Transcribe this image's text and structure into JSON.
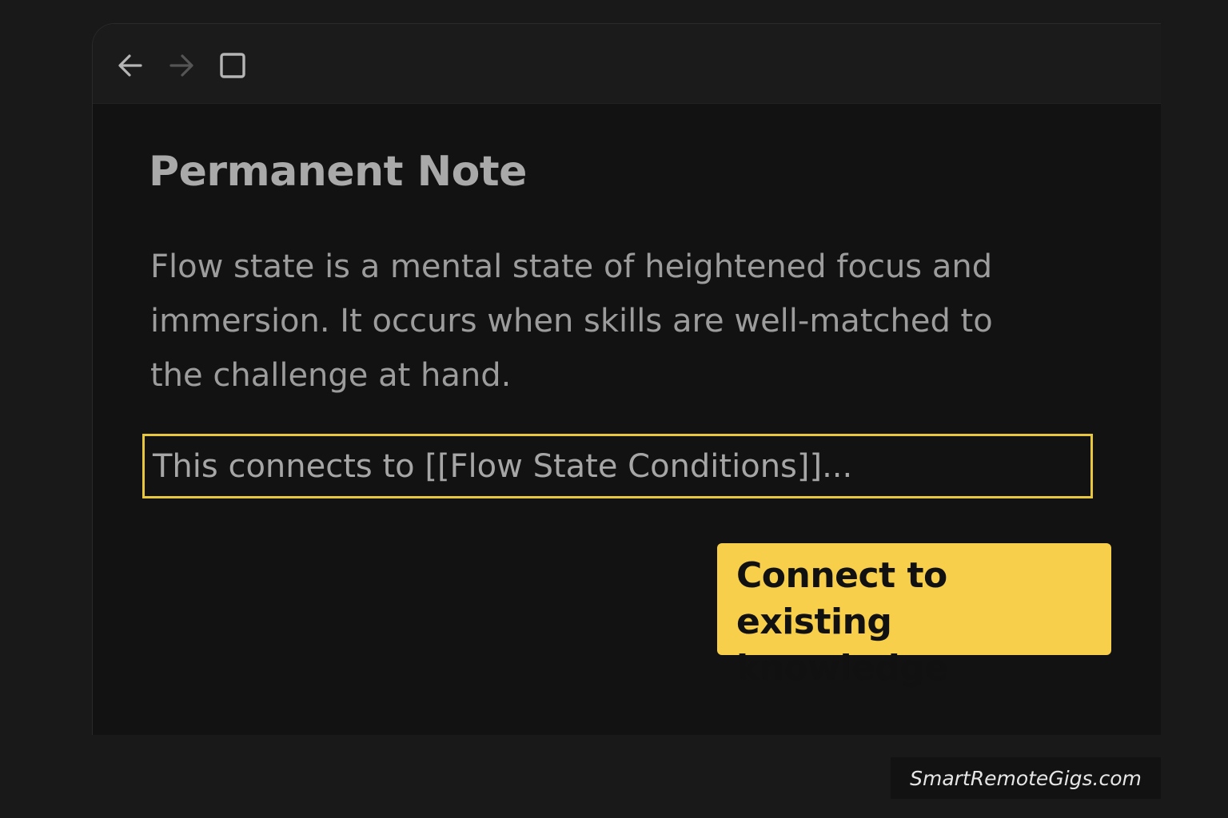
{
  "toolbar": {
    "back_icon": "arrow-left-icon",
    "forward_icon": "arrow-right-icon",
    "view_icon": "square-icon"
  },
  "note": {
    "title": "Permanent Note",
    "body": "Flow state is a mental state of heightened focus and immersion. It occurs when skills are well-matched to the challenge at hand.",
    "link_line": "This connects to [[Flow State Conditions]]..."
  },
  "callout": {
    "text": "Connect to existing knowledge"
  },
  "watermark": {
    "text": "SmartRemoteGigs.com"
  },
  "colors": {
    "background": "#191919",
    "editor": "#121212",
    "highlight": "#e8c73c",
    "callout": "#f7cf4a"
  }
}
